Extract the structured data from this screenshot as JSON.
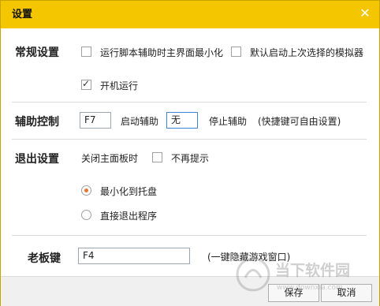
{
  "window": {
    "title": "设置"
  },
  "general": {
    "label": "常规设置",
    "minimize_option": "运行脚本辅助时主界面最小化",
    "minimize_checked": false,
    "default_emulator_option": "默认启动上次选择的模拟器",
    "default_emulator_checked": false,
    "autostart_option": "开机运行",
    "autostart_checked": true
  },
  "assist": {
    "label": "辅助控制",
    "start_key_value": "F7",
    "start_label": "启动辅助",
    "stop_key_value": "无",
    "stop_label": "停止辅助",
    "hint": "(快捷键可自由设置)"
  },
  "exit": {
    "label": "退出设置",
    "close_panel_label": "关闭主面板时",
    "no_prompt_option": "不再提示",
    "no_prompt_checked": false,
    "minimize_tray_option": "最小化到托盘",
    "exit_program_option": "直接退出程序",
    "selected": "最小化到托盘"
  },
  "boss_key": {
    "label": "老板键",
    "value": "F4",
    "hint": "(一键隐藏游戏窗口)"
  },
  "footer": {
    "save": "保存",
    "cancel": "取消"
  },
  "watermark": {
    "brand": "当下软件园",
    "url": "www.downxia.com"
  }
}
